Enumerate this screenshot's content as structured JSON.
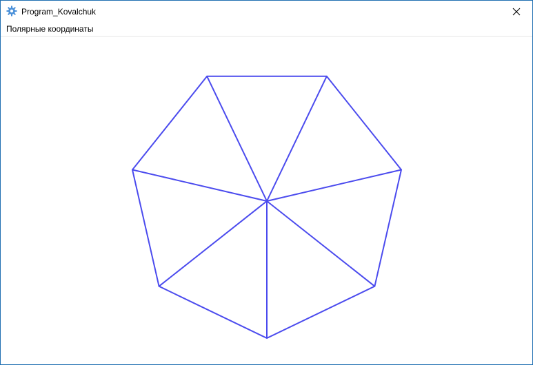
{
  "window": {
    "title": "Program_Kovalchuk",
    "app_icon": "gear-icon",
    "close_icon": "close-icon",
    "accent_color": "#1f6fb2"
  },
  "menu": {
    "items": [
      {
        "label": "Полярные координаты"
      }
    ]
  },
  "drawing": {
    "shape": "heptagon-fan",
    "vertex_count": 7,
    "stroke_color": "#4b4bee"
  }
}
